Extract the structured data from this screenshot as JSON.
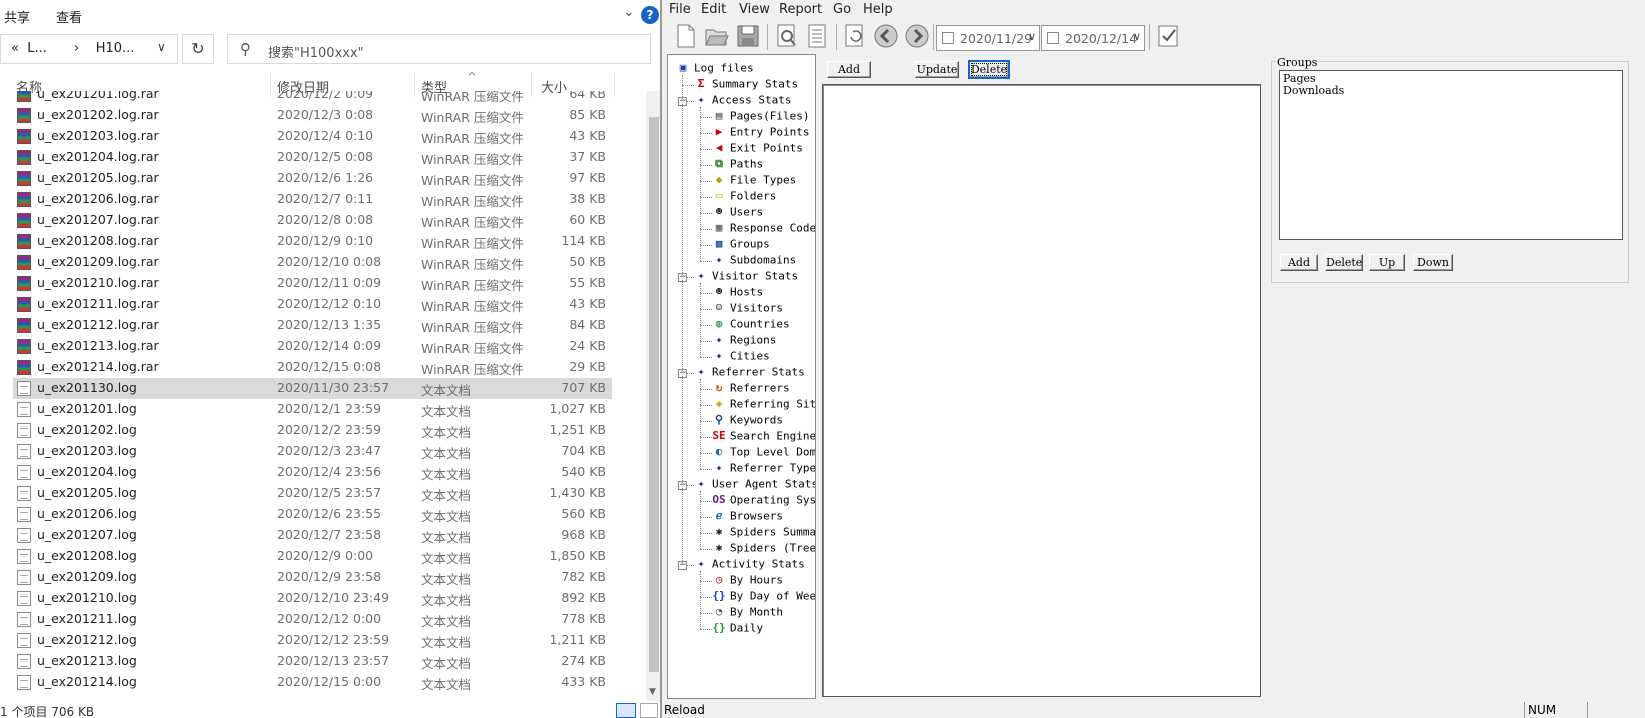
{
  "explorer": {
    "ribbon": {
      "share": "共享",
      "view": "查看",
      "help": "?"
    },
    "address": {
      "part1": "L...",
      "part2": "H10..."
    },
    "search_placeholder": "搜索\"H100xxx\"",
    "columns": {
      "name": "名称",
      "date": "修改日期",
      "type": "类型",
      "size": "大小"
    },
    "files": [
      {
        "name": "u_ex201201.log.rar",
        "date": "2020/12/2 0:09",
        "type": "WinRAR 压缩文件",
        "size": "64 KB",
        "kind": "rar"
      },
      {
        "name": "u_ex201202.log.rar",
        "date": "2020/12/3 0:08",
        "type": "WinRAR 压缩文件",
        "size": "85 KB",
        "kind": "rar"
      },
      {
        "name": "u_ex201203.log.rar",
        "date": "2020/12/4 0:10",
        "type": "WinRAR 压缩文件",
        "size": "43 KB",
        "kind": "rar"
      },
      {
        "name": "u_ex201204.log.rar",
        "date": "2020/12/5 0:08",
        "type": "WinRAR 压缩文件",
        "size": "37 KB",
        "kind": "rar"
      },
      {
        "name": "u_ex201205.log.rar",
        "date": "2020/12/6 1:26",
        "type": "WinRAR 压缩文件",
        "size": "97 KB",
        "kind": "rar"
      },
      {
        "name": "u_ex201206.log.rar",
        "date": "2020/12/7 0:11",
        "type": "WinRAR 压缩文件",
        "size": "38 KB",
        "kind": "rar"
      },
      {
        "name": "u_ex201207.log.rar",
        "date": "2020/12/8 0:08",
        "type": "WinRAR 压缩文件",
        "size": "60 KB",
        "kind": "rar"
      },
      {
        "name": "u_ex201208.log.rar",
        "date": "2020/12/9 0:10",
        "type": "WinRAR 压缩文件",
        "size": "114 KB",
        "kind": "rar"
      },
      {
        "name": "u_ex201209.log.rar",
        "date": "2020/12/10 0:08",
        "type": "WinRAR 压缩文件",
        "size": "50 KB",
        "kind": "rar"
      },
      {
        "name": "u_ex201210.log.rar",
        "date": "2020/12/11 0:09",
        "type": "WinRAR 压缩文件",
        "size": "55 KB",
        "kind": "rar"
      },
      {
        "name": "u_ex201211.log.rar",
        "date": "2020/12/12 0:10",
        "type": "WinRAR 压缩文件",
        "size": "43 KB",
        "kind": "rar"
      },
      {
        "name": "u_ex201212.log.rar",
        "date": "2020/12/13 1:35",
        "type": "WinRAR 压缩文件",
        "size": "84 KB",
        "kind": "rar"
      },
      {
        "name": "u_ex201213.log.rar",
        "date": "2020/12/14 0:09",
        "type": "WinRAR 压缩文件",
        "size": "24 KB",
        "kind": "rar"
      },
      {
        "name": "u_ex201214.log.rar",
        "date": "2020/12/15 0:08",
        "type": "WinRAR 压缩文件",
        "size": "29 KB",
        "kind": "rar"
      },
      {
        "name": "u_ex201130.log",
        "date": "2020/11/30 23:57",
        "type": "文本文档",
        "size": "707 KB",
        "kind": "txt",
        "selected": true
      },
      {
        "name": "u_ex201201.log",
        "date": "2020/12/1 23:59",
        "type": "文本文档",
        "size": "1,027 KB",
        "kind": "txt"
      },
      {
        "name": "u_ex201202.log",
        "date": "2020/12/2 23:59",
        "type": "文本文档",
        "size": "1,251 KB",
        "kind": "txt"
      },
      {
        "name": "u_ex201203.log",
        "date": "2020/12/3 23:47",
        "type": "文本文档",
        "size": "704 KB",
        "kind": "txt"
      },
      {
        "name": "u_ex201204.log",
        "date": "2020/12/4 23:56",
        "type": "文本文档",
        "size": "540 KB",
        "kind": "txt"
      },
      {
        "name": "u_ex201205.log",
        "date": "2020/12/5 23:57",
        "type": "文本文档",
        "size": "1,430 KB",
        "kind": "txt"
      },
      {
        "name": "u_ex201206.log",
        "date": "2020/12/6 23:55",
        "type": "文本文档",
        "size": "560 KB",
        "kind": "txt"
      },
      {
        "name": "u_ex201207.log",
        "date": "2020/12/7 23:58",
        "type": "文本文档",
        "size": "968 KB",
        "kind": "txt"
      },
      {
        "name": "u_ex201208.log",
        "date": "2020/12/9 0:00",
        "type": "文本文档",
        "size": "1,850 KB",
        "kind": "txt"
      },
      {
        "name": "u_ex201209.log",
        "date": "2020/12/9 23:58",
        "type": "文本文档",
        "size": "782 KB",
        "kind": "txt"
      },
      {
        "name": "u_ex201210.log",
        "date": "2020/12/10 23:49",
        "type": "文本文档",
        "size": "892 KB",
        "kind": "txt"
      },
      {
        "name": "u_ex201211.log",
        "date": "2020/12/12 0:00",
        "type": "文本文档",
        "size": "778 KB",
        "kind": "txt"
      },
      {
        "name": "u_ex201212.log",
        "date": "2020/12/12 23:59",
        "type": "文本文档",
        "size": "1,211 KB",
        "kind": "txt"
      },
      {
        "name": "u_ex201213.log",
        "date": "2020/12/13 23:57",
        "type": "文本文档",
        "size": "274 KB",
        "kind": "txt"
      },
      {
        "name": "u_ex201214.log",
        "date": "2020/12/15 0:00",
        "type": "文本文档",
        "size": "433 KB",
        "kind": "txt"
      }
    ],
    "status": "1 个项目  706 KB"
  },
  "app": {
    "menu": [
      "File",
      "Edit",
      "View",
      "Report",
      "Go",
      "Help"
    ],
    "date_from": "2020/11/29",
    "date_to": "2020/12/14",
    "buttons": {
      "add": "Add",
      "update": "Update",
      "delete": "Delete"
    },
    "groups_label": "Groups",
    "groups_items": [
      "Pages",
      "Downloads"
    ],
    "group_buttons": {
      "add": "Add",
      "delete": "Delete",
      "up": "Up",
      "down": "Down"
    },
    "tree": [
      {
        "label": "Log files",
        "level": 0,
        "icon": "log-files-icon",
        "glyph": "▣",
        "color": "#1a3f9b"
      },
      {
        "label": "Summary Stats",
        "level": 1,
        "icon": "sigma-icon",
        "glyph": "Σ",
        "color": "#d00000"
      },
      {
        "label": "Access Stats",
        "level": 1,
        "icon": "diamond-icon",
        "glyph": "✦",
        "color": "#1a1a6e",
        "expander": true
      },
      {
        "label": "Pages(Files)",
        "level": 2,
        "icon": "page-icon",
        "glyph": "▤",
        "color": "#444"
      },
      {
        "label": "Entry Points",
        "level": 2,
        "icon": "entry-icon",
        "glyph": "▶",
        "color": "#d00000"
      },
      {
        "label": "Exit Points",
        "level": 2,
        "icon": "exit-icon",
        "glyph": "◀",
        "color": "#d00000"
      },
      {
        "label": "Paths",
        "level": 2,
        "icon": "paths-icon",
        "glyph": "⧉",
        "color": "#2a6e2a"
      },
      {
        "label": "File Types",
        "level": 2,
        "icon": "file-types-icon",
        "glyph": "◆",
        "color": "#c99a00"
      },
      {
        "label": "Folders",
        "level": 2,
        "icon": "folder-icon",
        "glyph": "▭",
        "color": "#c9a200"
      },
      {
        "label": "Users",
        "level": 2,
        "icon": "user-icon",
        "glyph": "☻",
        "color": "#222"
      },
      {
        "label": "Response Codes",
        "level": 2,
        "icon": "response-codes-icon",
        "glyph": "▦",
        "color": "#555"
      },
      {
        "label": "Groups",
        "level": 2,
        "icon": "groups-icon",
        "glyph": "▩",
        "color": "#1a3f9b"
      },
      {
        "label": "Subdomains",
        "level": 2,
        "icon": "diamond-icon",
        "glyph": "✦",
        "color": "#1a1a6e"
      },
      {
        "label": "Visitor Stats",
        "level": 1,
        "icon": "diamond-icon",
        "glyph": "✦",
        "color": "#1a1a6e",
        "expander": true
      },
      {
        "label": "Hosts",
        "level": 2,
        "icon": "host-icon",
        "glyph": "☻",
        "color": "#222"
      },
      {
        "label": "Visitors",
        "level": 2,
        "icon": "visitor-icon",
        "glyph": "☺",
        "color": "#222"
      },
      {
        "label": "Countries",
        "level": 2,
        "icon": "globe-icon",
        "glyph": "◍",
        "color": "#1e8a3a"
      },
      {
        "label": "Regions",
        "level": 2,
        "icon": "diamond-icon",
        "glyph": "✦",
        "color": "#1a1a6e"
      },
      {
        "label": "Cities",
        "level": 2,
        "icon": "diamond-icon",
        "glyph": "✦",
        "color": "#1a1a6e"
      },
      {
        "label": "Referrer Stats",
        "level": 1,
        "icon": "diamond-icon",
        "glyph": "✦",
        "color": "#1a1a6e",
        "expander": true
      },
      {
        "label": "Referrers",
        "level": 2,
        "icon": "referrer-icon",
        "glyph": "↻",
        "color": "#c94a00"
      },
      {
        "label": "Referring Sites",
        "level": 2,
        "icon": "referring-sites-icon",
        "glyph": "◈",
        "color": "#c99a00"
      },
      {
        "label": "Keywords",
        "level": 2,
        "icon": "magnifier-icon",
        "glyph": "⚲",
        "color": "#1a3f9b"
      },
      {
        "label": "Search Engines",
        "level": 2,
        "icon": "search-engines-icon",
        "glyph": "SE",
        "color": "#d00000"
      },
      {
        "label": "Top Level Domains",
        "level": 2,
        "icon": "tld-icon",
        "glyph": "◐",
        "color": "#1a6e9b"
      },
      {
        "label": "Referrer Types",
        "level": 2,
        "icon": "diamond-icon",
        "glyph": "✦",
        "color": "#1a1a6e"
      },
      {
        "label": "User Agent Stats",
        "level": 1,
        "icon": "diamond-icon",
        "glyph": "✦",
        "color": "#1a1a6e",
        "expander": true
      },
      {
        "label": "Operating Systems",
        "level": 2,
        "icon": "os-icon",
        "glyph": "OS",
        "color": "#6a1a8a"
      },
      {
        "label": "Browsers",
        "level": 2,
        "icon": "browser-icon",
        "glyph": "ℯ",
        "color": "#1a62c9"
      },
      {
        "label": "Spiders Summary",
        "level": 2,
        "icon": "spider-icon",
        "glyph": "✱",
        "color": "#222"
      },
      {
        "label": "Spiders (Tree)",
        "level": 2,
        "icon": "spider-icon",
        "glyph": "✱",
        "color": "#222"
      },
      {
        "label": "Activity Stats",
        "level": 1,
        "icon": "diamond-icon",
        "glyph": "✦",
        "color": "#1a1a6e",
        "expander": true
      },
      {
        "label": "By Hours",
        "level": 2,
        "icon": "clock-icon",
        "glyph": "◷",
        "color": "#d00000"
      },
      {
        "label": "By Day of Week",
        "level": 2,
        "icon": "braces-icon",
        "glyph": "{}",
        "color": "#1a3fd0"
      },
      {
        "label": "By Month",
        "level": 2,
        "icon": "month-icon",
        "glyph": "◔",
        "color": "#555"
      },
      {
        "label": "Daily",
        "level": 2,
        "icon": "braces-icon",
        "glyph": "{}",
        "color": "#1ea01e"
      }
    ],
    "status": {
      "left": "Reload",
      "num": "NUM"
    }
  }
}
